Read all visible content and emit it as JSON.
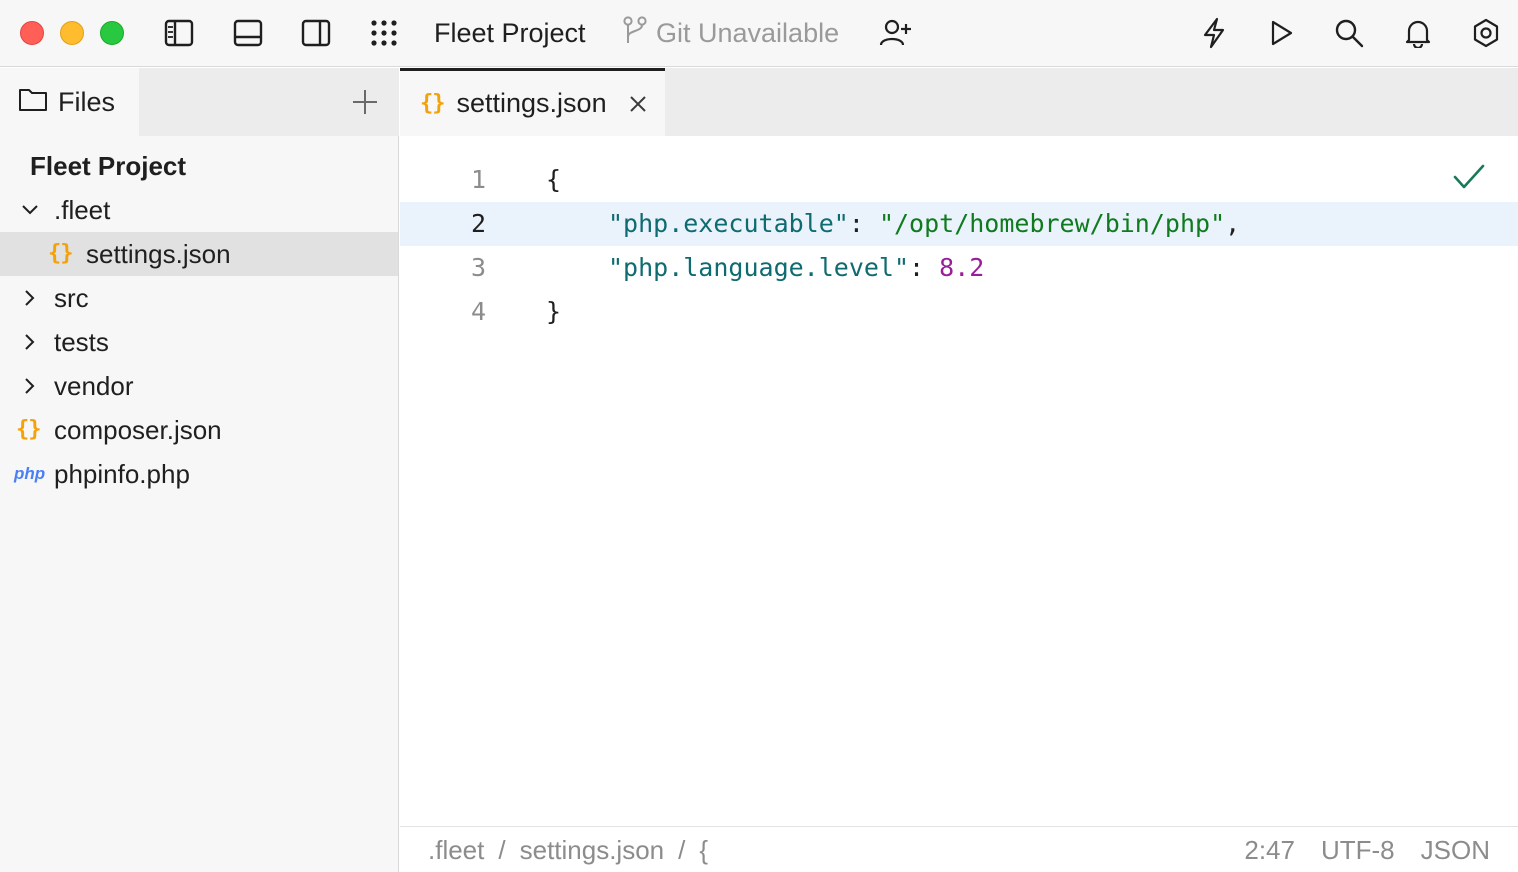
{
  "titlebar": {
    "project_title": "Fleet Project",
    "git_status": "Git Unavailable"
  },
  "sidebar": {
    "tab_label": "Files",
    "project_root": "Fleet Project",
    "tree": [
      {
        "label": ".fleet",
        "kind": "folder",
        "expanded": true
      },
      {
        "label": "settings.json",
        "kind": "json",
        "selected": true
      },
      {
        "label": "src",
        "kind": "folder",
        "expanded": false
      },
      {
        "label": "tests",
        "kind": "folder",
        "expanded": false
      },
      {
        "label": "vendor",
        "kind": "folder",
        "expanded": false
      },
      {
        "label": "composer.json",
        "kind": "json"
      },
      {
        "label": "phpinfo.php",
        "kind": "php"
      }
    ],
    "json_glyph": "{}",
    "php_glyph": "php"
  },
  "editor": {
    "tab_label": "settings.json",
    "lines": [
      {
        "number": "1",
        "text": "{"
      },
      {
        "number": "2",
        "key": "\"php.executable\"",
        "sep": ": ",
        "value": "\"/opt/homebrew/bin/php\"",
        "tail": ","
      },
      {
        "number": "3",
        "key": "\"php.language.level\"",
        "sep": ": ",
        "value": "8.2",
        "tail": ""
      },
      {
        "number": "4",
        "text": "}"
      }
    ]
  },
  "statusbar": {
    "breadcrumb": [
      ".fleet",
      "/",
      "settings.json",
      "/",
      "{"
    ],
    "position": "2:47",
    "encoding": "UTF-8",
    "language": "JSON"
  },
  "colors": {
    "close": "#ff5f57",
    "minimize": "#febc2e",
    "maximize": "#28c840",
    "json_icon": "#f2a20c",
    "php_icon": "#4a7ff5",
    "string": "#0f7a1e",
    "key": "#0e6b70",
    "number": "#991f99"
  }
}
